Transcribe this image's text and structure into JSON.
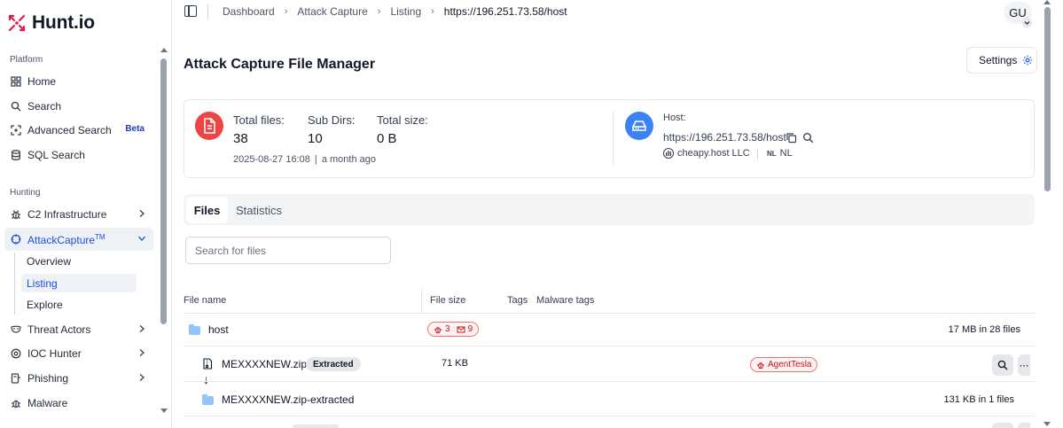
{
  "brand": {
    "name": "Hunt.io",
    "accent": "#1d4ed8",
    "logo_color": "#e11d48"
  },
  "sidebar": {
    "platform_label": "Platform",
    "platform_items": [
      {
        "label": "Home",
        "icon": "grid-icon"
      },
      {
        "label": "Search",
        "icon": "search-icon"
      },
      {
        "label": "Advanced Search",
        "icon": "scan-icon",
        "badge": "Beta"
      },
      {
        "label": "SQL Search",
        "icon": "database-icon"
      }
    ],
    "hunting_label": "Hunting",
    "hunting_items": [
      {
        "label": "C2 Infrastructure",
        "icon": "bug-icon"
      },
      {
        "label": "AttackCapture",
        "sup": "TM",
        "icon": "crosshair-icon",
        "expanded": true
      },
      {
        "label": "Threat Actors",
        "icon": "mask-icon"
      },
      {
        "label": "IOC Hunter",
        "icon": "target-icon"
      },
      {
        "label": "Phishing",
        "icon": "hook-icon"
      },
      {
        "label": "Malware",
        "icon": "malware-icon"
      }
    ],
    "attack_capture_subitems": [
      "Overview",
      "Listing",
      "Explore"
    ],
    "active_subitem": "Listing"
  },
  "topbar": {
    "breadcrumbs": [
      "Dashboard",
      "Attack Capture",
      "Listing",
      "https://196.251.73.58/host"
    ],
    "avatar_initials": "GU"
  },
  "page": {
    "title": "Attack Capture File Manager",
    "settings_label": "Settings"
  },
  "summary": {
    "total_files_label": "Total files:",
    "total_files": "38",
    "sub_dirs_label": "Sub Dirs:",
    "sub_dirs": "10",
    "total_size_label": "Total size:",
    "total_size": "0 B",
    "date": "2025-08-27 16:08",
    "relative": "a month ago",
    "host_label": "Host:",
    "host_url": "https://196.251.73.58/host",
    "org": "cheapy.host LLC",
    "country_code": "NL",
    "country": "NL"
  },
  "tabs": [
    "Files",
    "Statistics"
  ],
  "active_tab": "Files",
  "search": {
    "placeholder": "Search for files",
    "value": ""
  },
  "table": {
    "headers": [
      "File name",
      "File size",
      "Tags",
      "Malware tags"
    ],
    "rows": [
      {
        "type": "folder",
        "name": "host",
        "bug_count": "3",
        "mail_count": "9",
        "size_summary": "17 MB in 28 files"
      },
      {
        "type": "file",
        "name": "MEXXXXNEW.zip",
        "tag": "Extracted",
        "size": "71 KB",
        "malware_tag": "AgentTesla"
      },
      {
        "type": "folder",
        "name": "MEXXXXNEW.zip-extracted",
        "size_summary": "131 KB in 1 files"
      }
    ]
  }
}
